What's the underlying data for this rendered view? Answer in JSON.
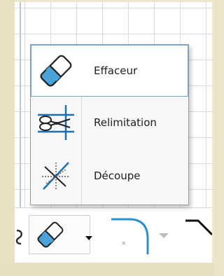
{
  "menu": {
    "items": [
      {
        "label": "Effaceur",
        "icon": "eraser-icon",
        "selected": true
      },
      {
        "label": "Relimitation",
        "icon": "trim-scissors-icon",
        "selected": false
      },
      {
        "label": "Découpe",
        "icon": "split-icon",
        "selected": false
      }
    ]
  },
  "toolbar": {
    "tools": [
      {
        "icon": "eraser-icon",
        "has_dropdown": true
      },
      {
        "icon": "fillet-icon",
        "has_dropdown": true
      },
      {
        "icon": "chamfer-icon",
        "has_dropdown": false
      }
    ]
  },
  "colors": {
    "background": "#ece4c8",
    "selection_border": "#6fa7d9",
    "eraser_blue": "#4aa3d8",
    "fillet_blue": "#2f8fc9"
  }
}
